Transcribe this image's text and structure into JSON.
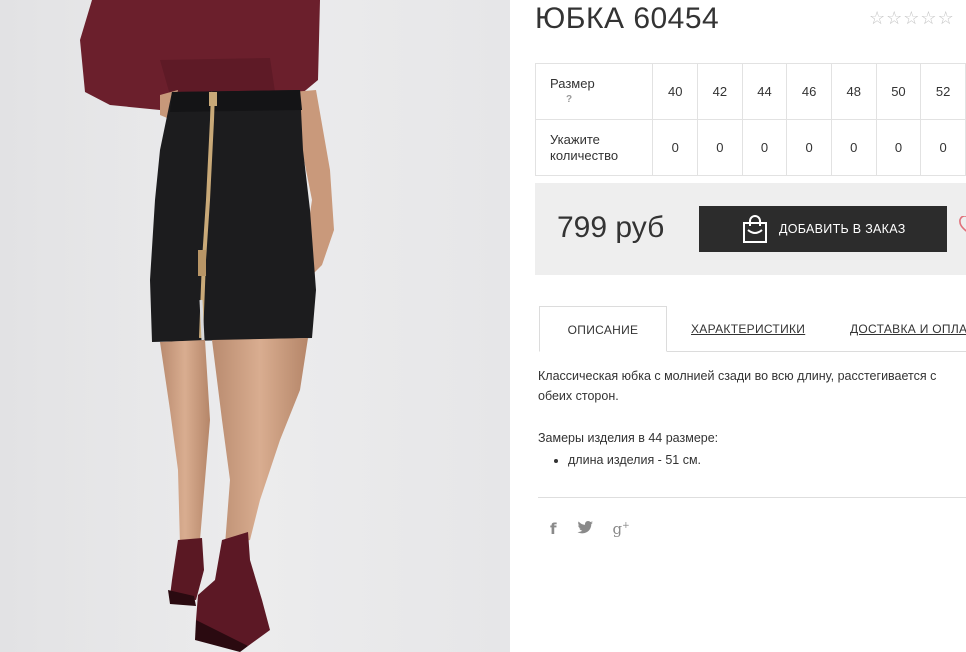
{
  "product": {
    "title": "ЮБКА 60454",
    "rating_stars": "☆☆☆☆☆",
    "photo_icon": "product-photo"
  },
  "size_table": {
    "size_label": "Размер",
    "help_mark": "?",
    "qty_label_line1": "Укажите",
    "qty_label_line2": "количество",
    "sizes": [
      "40",
      "42",
      "44",
      "46",
      "48",
      "50",
      "52"
    ],
    "quantities": [
      "0",
      "0",
      "0",
      "0",
      "0",
      "0",
      "0"
    ]
  },
  "buy": {
    "price": "799 руб",
    "add_button": "ДОБАВИТЬ В ЗАКАЗ",
    "bag_icon": "shopping-bag-icon",
    "heart_icon": "heart-icon"
  },
  "tabs": {
    "description": "ОПИСАНИЕ",
    "characteristics": "ХАРАКТЕРИСТИКИ",
    "delivery": "ДОСТАВКА И ОПЛАТА"
  },
  "description": {
    "text": "Классическая юбка с молнией сзади во всю длину, расстегивается с обеих сторон.",
    "measure_title": "Замеры изделия в 44 размере:",
    "measure_item": "длина изделия - 51 см."
  },
  "social": {
    "facebook": "f",
    "twitter": "🐦",
    "google_plus": "g+"
  },
  "colors": {
    "button_bg": "#2c2c2c",
    "buy_box_bg": "#eeeeee",
    "photo_bg": "#e9e9ea",
    "heart": "#e0707a"
  }
}
